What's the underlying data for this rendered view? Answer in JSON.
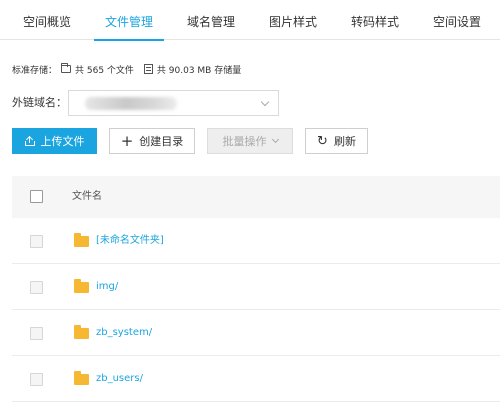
{
  "tabs": [
    {
      "label": "空间概览",
      "active": false
    },
    {
      "label": "文件管理",
      "active": true
    },
    {
      "label": "域名管理",
      "active": false
    },
    {
      "label": "图片样式",
      "active": false
    },
    {
      "label": "转码样式",
      "active": false
    },
    {
      "label": "空间设置",
      "active": false
    }
  ],
  "storage": {
    "type_label": "标准存储：",
    "files_text": "共 565 个文件",
    "size_text": "共 90.03 MB 存储量"
  },
  "domain": {
    "label": "外链域名：",
    "value_obscured": true
  },
  "toolbar": {
    "upload_label": "上传文件",
    "mkdir_label": "创建目录",
    "batch_label": "批量操作",
    "refresh_label": "刷新"
  },
  "table": {
    "column_name": "文件名",
    "rows": [
      {
        "name": "[未命名文件夹]"
      },
      {
        "name": "img/"
      },
      {
        "name": "zb_system/"
      },
      {
        "name": "zb_users/"
      }
    ]
  },
  "colors": {
    "accent": "#1ba5e0",
    "folder": "#f6b733"
  },
  "icons": {
    "files": "folder-outline-icon",
    "size": "database-icon",
    "upload": "upload-icon",
    "mkdir": "plus-icon",
    "refresh": "refresh-icon",
    "row": "folder-icon"
  }
}
